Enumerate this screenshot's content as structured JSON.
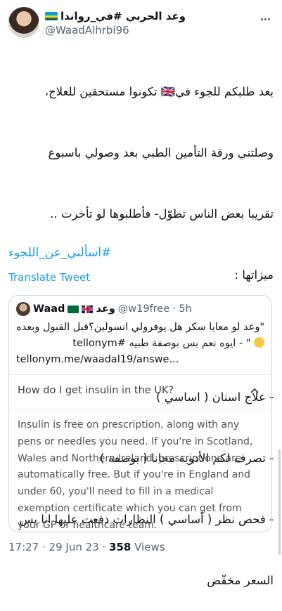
{
  "author": {
    "display_name": "وعد الحربي #في_رواندا",
    "handle": "@WaadAlhrbi96"
  },
  "tweet": {
    "lines": [
      "بعد طلبكم للجوء في🇬🇧 تكونوا مستحقين للعلاج،",
      "وصلتني ورقة التأمين الطبي بعد وصولي باسبوع",
      "تقريبا بعض الناس تطوّل- فأطلبوها لو تأخرت ..",
      "ميزاتها :",
      "",
      "- علاج اسنان ( اساسي )",
      "- تصرف لكم الأدوية مجانا ( بوصفة )",
      "- فحص نظر ( أساسي ) النظارات دفعت عليها انا بس",
      "السعر مخفّض"
    ],
    "hashtag": "#اسألني_عن_اللجوء",
    "translate_label": "Translate Tweet"
  },
  "quoted": {
    "name": "Waad",
    "name_ar": "وعد",
    "handle": "@w19free",
    "time": "· 5h",
    "line1": "\"وعد لو معايا سكر هل يوفرولي انسولين؟قبل القبول وبعده",
    "line2": "\" - ايوه نعم بس بوصفة طبيه #tellonym",
    "line3": "tellonym.me/waadal19/answe..."
  },
  "faq": {
    "question": "How do I get insulin in the UK?",
    "answer": "Insulin is free on prescription, along with any pens or needles you need. If you're in Scotland, Wales and Northern Ireland, prescriptions are automatically free. But if you're in England and under 60, you'll need to fill in a medical exemption certificate which you can get from your GP or healthcare team."
  },
  "footer": {
    "time": "17:27",
    "date": "· 29 Jun 23 ·",
    "views_count": "358",
    "views_label": "Views"
  },
  "icons": {
    "more": "more-icon",
    "chevron": "chevron-up-icon"
  },
  "colors": {
    "link": "#1d9bf0",
    "muted": "#536471"
  }
}
